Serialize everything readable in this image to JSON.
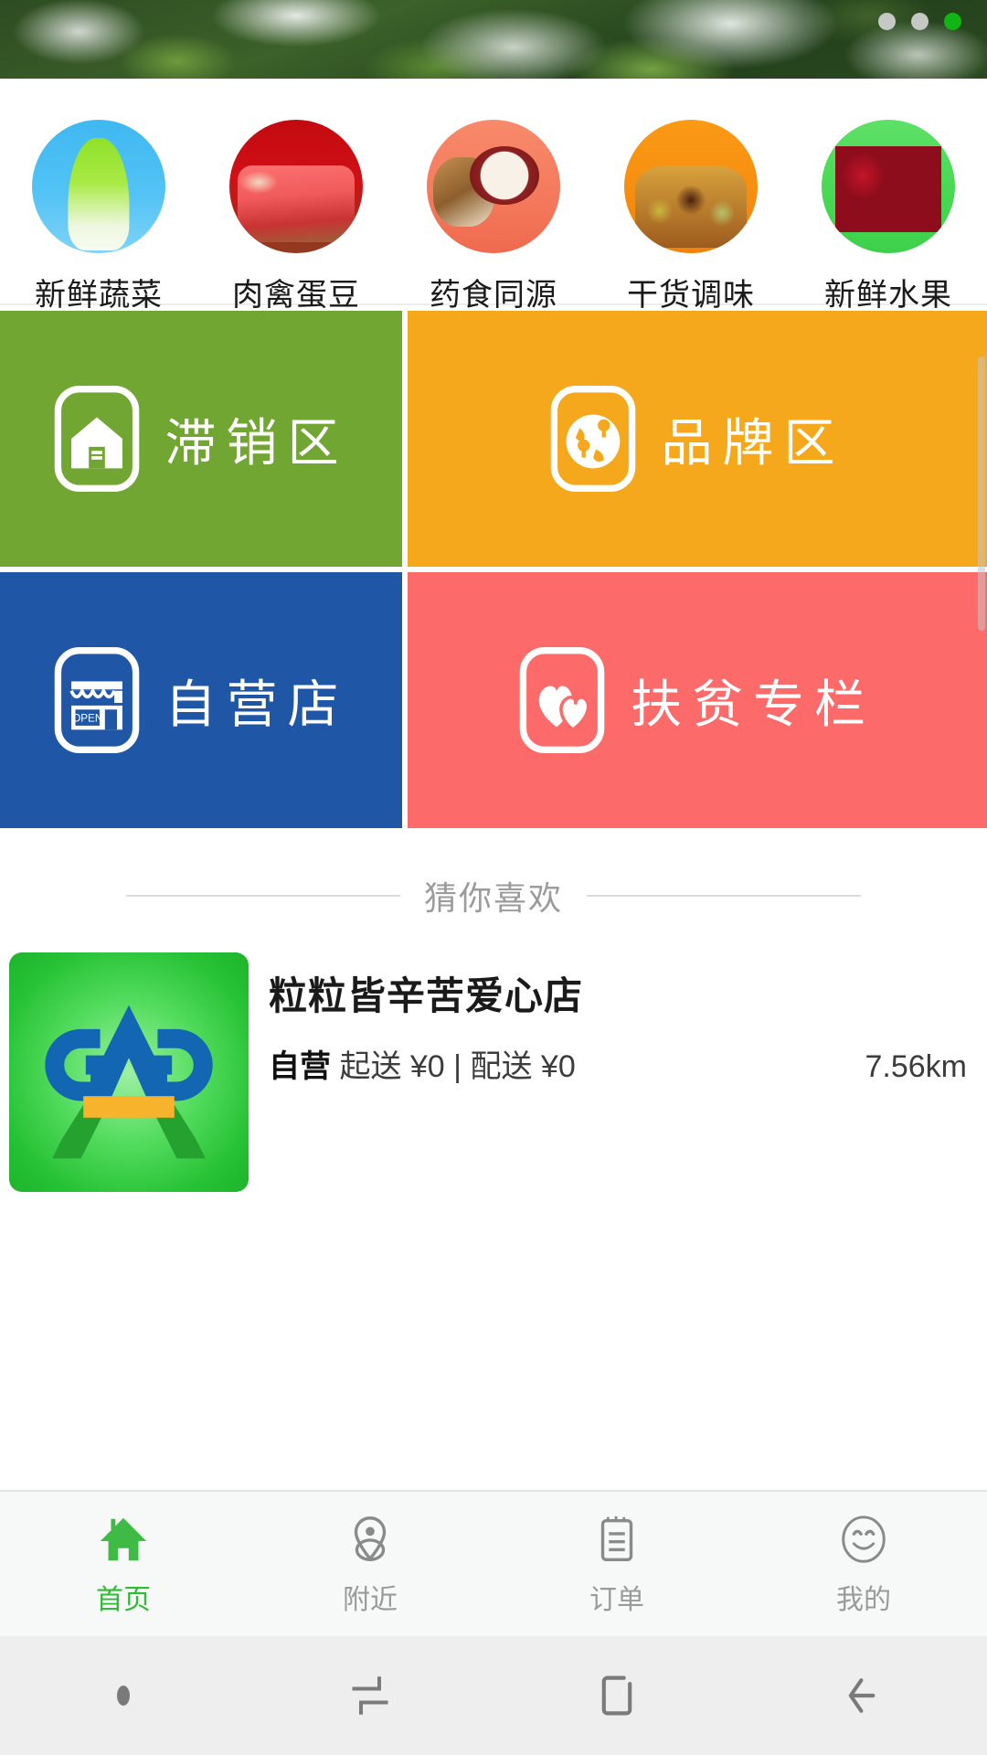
{
  "banner": {
    "name": "promo-banner",
    "alt": "vegetable field with frost covers",
    "dots": [
      {
        "active": false
      },
      {
        "active": false
      },
      {
        "active": true
      }
    ],
    "active_color": "#12b516",
    "inactive_color": "#c6c8c6"
  },
  "categories": [
    {
      "label": "新鲜蔬菜",
      "icon": "fresh-vegetables-icon",
      "bg": "#52c3f5"
    },
    {
      "label": "肉禽蛋豆",
      "icon": "meat-poultry-egg-icon",
      "bg": "#d01016"
    },
    {
      "label": "药食同源",
      "icon": "medicinal-food-icon",
      "bg": "#f4795c"
    },
    {
      "label": "干货调味",
      "icon": "dry-goods-seasoning-icon",
      "bg": "#f78f10"
    },
    {
      "label": "新鲜水果",
      "icon": "fresh-fruit-icon",
      "bg": "#49d955"
    }
  ],
  "tiles": [
    {
      "label": "滞销区",
      "icon": "warehouse-icon",
      "color": "#72a632"
    },
    {
      "label": "品牌区",
      "icon": "globe-brand-icon",
      "color": "#f5a81c"
    },
    {
      "label": "自营店",
      "icon": "shop-open-icon",
      "color": "#1f56a5"
    },
    {
      "label": "扶贫专栏",
      "icon": "hearts-icon",
      "color": "#fc6a6a"
    }
  ],
  "recommend": {
    "section_title": "猜你喜欢",
    "shop": {
      "logo": "gap-logo",
      "name": "粒粒皆辛苦爱心店",
      "badge": "自营",
      "min_order": "起送 ¥0",
      "separator": "|",
      "delivery_fee": "配送 ¥0",
      "distance": "7.56km"
    }
  },
  "tabbar": {
    "active_color": "#2fbb33",
    "inactive_color": "#9a9a9a",
    "items": [
      {
        "label": "首页",
        "icon": "home-icon",
        "active": true
      },
      {
        "label": "附近",
        "icon": "location-pin-icon",
        "active": false
      },
      {
        "label": "订单",
        "icon": "clipboard-order-icon",
        "active": false
      },
      {
        "label": "我的",
        "icon": "smiley-profile-icon",
        "active": false
      }
    ]
  },
  "navbar": {
    "items": [
      {
        "icon": "dot-indicator-icon"
      },
      {
        "icon": "recents-icon"
      },
      {
        "icon": "home-square-icon"
      },
      {
        "icon": "back-arrow-icon"
      }
    ]
  }
}
